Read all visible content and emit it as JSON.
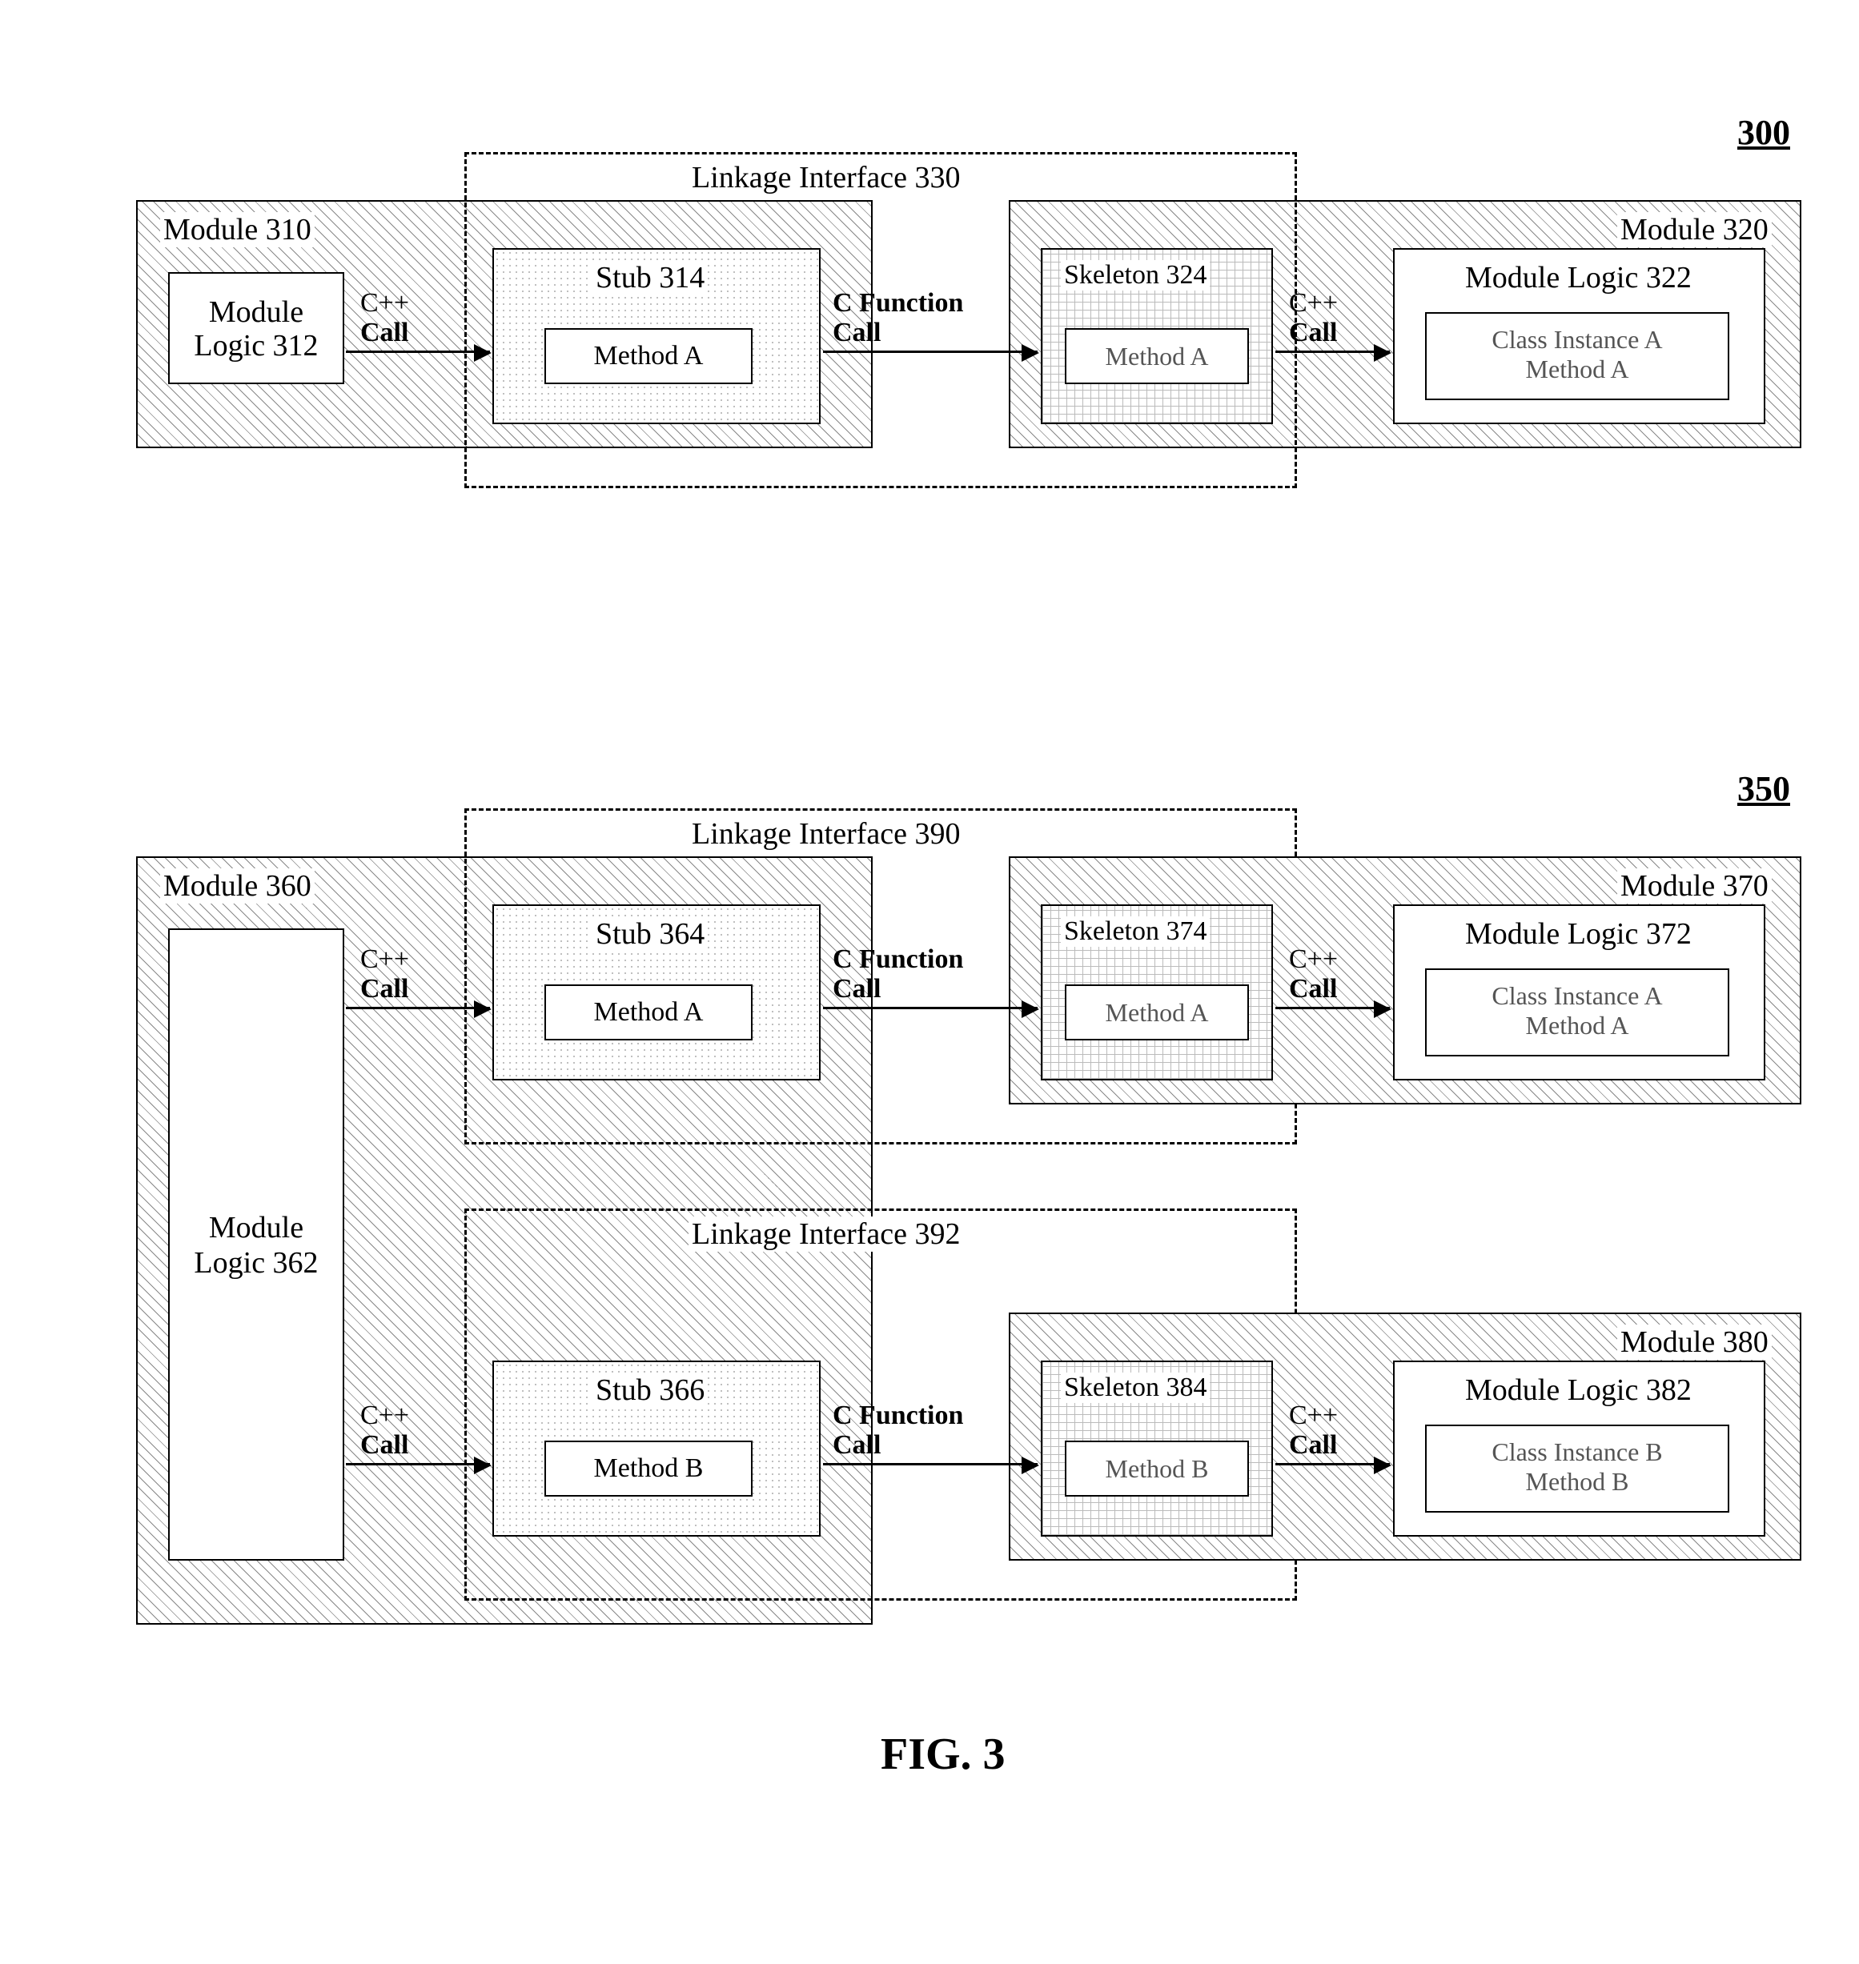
{
  "figure_caption": "FIG. 3",
  "diagrams": {
    "top": {
      "id": "300",
      "module_left": {
        "title": "Module 310",
        "logic": "Module Logic 312"
      },
      "linkage": {
        "title": "Linkage Interface 330",
        "stub": {
          "title": "Stub 314",
          "method": "Method A"
        },
        "skeleton": {
          "title": "Skeleton 324",
          "method": "Method A"
        }
      },
      "module_right": {
        "title": "Module 320",
        "logic": {
          "title": "Module Logic 322",
          "line1": "Class Instance A",
          "line2": "Method A"
        }
      },
      "calls": {
        "cpp": "C++",
        "call": "Call",
        "cfunc": "C Function"
      }
    },
    "bottom": {
      "id": "350",
      "module_left": {
        "title": "Module 360",
        "logic": "Module Logic 362"
      },
      "linkage1": {
        "title": "Linkage Interface 390",
        "stub": {
          "title": "Stub 364",
          "method": "Method A"
        },
        "skeleton": {
          "title": "Skeleton 374",
          "method": "Method A"
        }
      },
      "module_right1": {
        "title": "Module 370",
        "logic": {
          "title": "Module Logic 372",
          "line1": "Class Instance A",
          "line2": "Method A"
        }
      },
      "linkage2": {
        "title": "Linkage Interface 392",
        "stub": {
          "title": "Stub 366",
          "method": "Method B"
        },
        "skeleton": {
          "title": "Skeleton 384",
          "method": "Method B"
        }
      },
      "module_right2": {
        "title": "Module 380",
        "logic": {
          "title": "Module Logic 382",
          "line1": "Class Instance B",
          "line2": "Method B"
        }
      },
      "calls": {
        "cpp": "C++",
        "call": "Call",
        "cfunc": "C Function"
      }
    }
  }
}
